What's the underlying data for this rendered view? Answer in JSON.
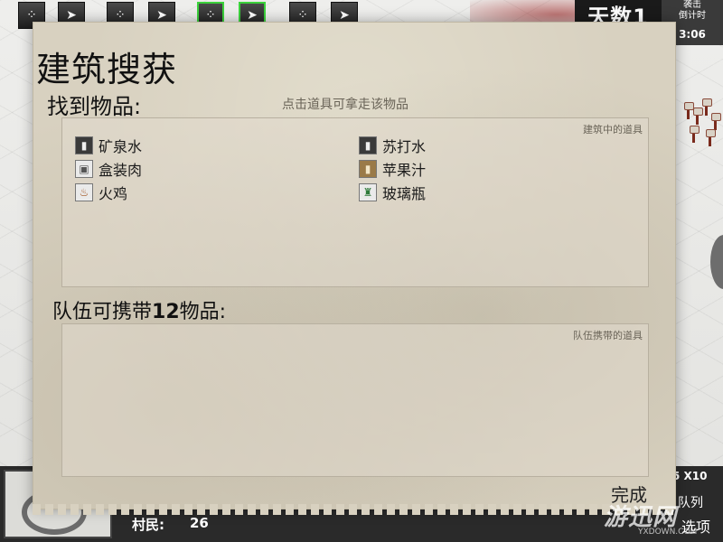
{
  "hotbar": {
    "slots": [
      {
        "icon": "scatter-icon"
      },
      {
        "icon": "bird-icon"
      },
      {
        "icon": "scatter-icon"
      },
      {
        "icon": "bird-icon"
      },
      {
        "icon": "scatter-icon"
      },
      {
        "icon": "bird-icon"
      },
      {
        "icon": "scatter-icon"
      },
      {
        "icon": "bird-icon"
      }
    ],
    "days_text": "天数1",
    "raid_line1": "袭击",
    "raid_line2": "倒计时",
    "raid_time": "3:06"
  },
  "dialog": {
    "title": "建筑搜获",
    "found_label": "找到物品:",
    "hint": "点击道具可拿走该物品",
    "building_items_caption": "建筑中的道具",
    "items": [
      {
        "label": "矿泉水",
        "icon": "bottle-icon"
      },
      {
        "label": "苏打水",
        "icon": "bottle-icon"
      },
      {
        "label": "盒装肉",
        "icon": "box-icon"
      },
      {
        "label": "苹果汁",
        "icon": "juice-icon"
      },
      {
        "label": "火鸡",
        "icon": "turkey-icon"
      },
      {
        "label": "玻璃瓶",
        "icon": "glass-bottle-icon"
      }
    ],
    "carry_prefix": "队伍可携带",
    "carry_count": "12",
    "carry_suffix": "物品:",
    "team_items_caption": "队伍携带的道具",
    "done_label": "完成"
  },
  "hud": {
    "villager_label": "村民:",
    "villager_count": "26",
    "speed_label": "5 X10",
    "queue_label": "队列",
    "options_label": "选项"
  },
  "watermark": {
    "text": "游迅网",
    "sub": "YXDOWN.COM"
  }
}
